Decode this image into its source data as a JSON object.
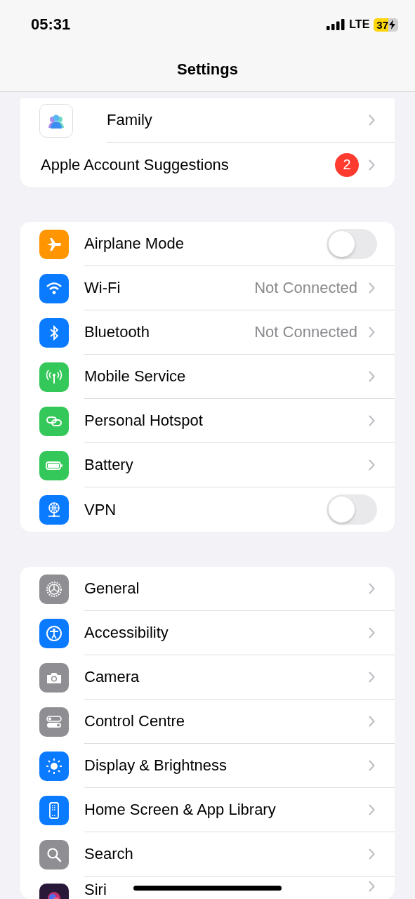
{
  "status_bar": {
    "time": "05:31",
    "network": "LTE",
    "battery": "37"
  },
  "nav": {
    "title": "Settings"
  },
  "sections": [
    {
      "items": [
        {
          "label": "Family",
          "kind": "link",
          "color": "#ffffff"
        },
        {
          "label": "Apple Account Suggestions",
          "kind": "badge",
          "badge": "2"
        }
      ]
    },
    {
      "items": [
        {
          "label": "Airplane Mode",
          "kind": "toggle",
          "on": false,
          "color": "#ff9500"
        },
        {
          "label": "Wi-Fi",
          "kind": "detail",
          "value": "Not Connected",
          "color": "#0a7aff"
        },
        {
          "label": "Bluetooth",
          "kind": "detail",
          "value": "Not Connected",
          "color": "#0a7aff"
        },
        {
          "label": "Mobile Service",
          "kind": "link",
          "color": "#34c759"
        },
        {
          "label": "Personal Hotspot",
          "kind": "link",
          "color": "#34c759"
        },
        {
          "label": "Battery",
          "kind": "link",
          "color": "#34c759"
        },
        {
          "label": "VPN",
          "kind": "toggle",
          "on": false,
          "color": "#0a7aff"
        }
      ]
    },
    {
      "items": [
        {
          "label": "General",
          "kind": "link",
          "color": "#8e8e93"
        },
        {
          "label": "Accessibility",
          "kind": "link",
          "color": "#0a7aff"
        },
        {
          "label": "Camera",
          "kind": "link",
          "color": "#8e8e93"
        },
        {
          "label": "Control Centre",
          "kind": "link",
          "color": "#8e8e93"
        },
        {
          "label": "Display & Brightness",
          "kind": "link",
          "color": "#0a7aff"
        },
        {
          "label": "Home Screen & App Library",
          "kind": "link",
          "color": "#0a7aff"
        },
        {
          "label": "Search",
          "kind": "link",
          "color": "#8e8e93"
        },
        {
          "label": "Siri",
          "kind": "link",
          "color": "#2a1838"
        }
      ]
    }
  ]
}
